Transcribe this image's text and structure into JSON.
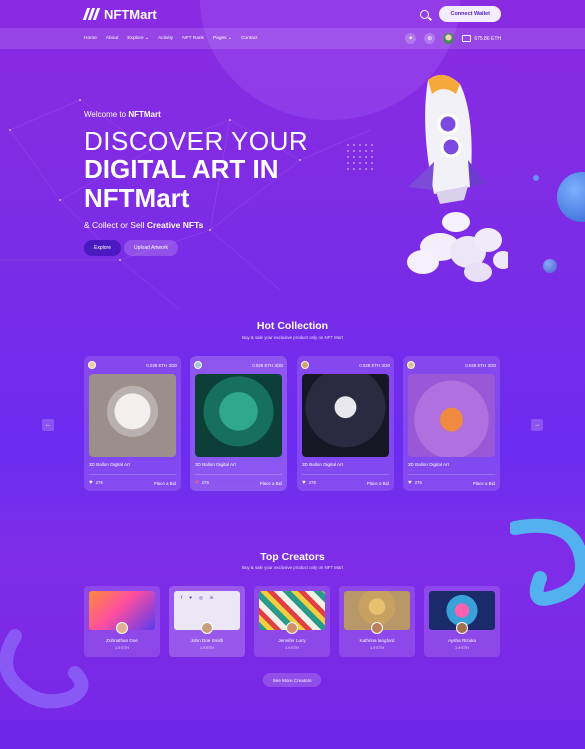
{
  "header": {
    "logo": "NFTMart",
    "connect_label": "Connect Wallet",
    "nav": [
      "Home",
      "About",
      "Explore",
      "Activity",
      "NFT Rank",
      "Pages",
      "Contact"
    ],
    "balance": "675.86 ETH"
  },
  "hero": {
    "welcome_prefix": "Welcome to",
    "welcome_brand": "NFTMart",
    "line1": "DISCOVER YOUR",
    "line2": "DIGITAL ART IN",
    "line3": "NFTMart",
    "sub_prefix": "& Collect or Sell",
    "sub_bold": "Creative NFTs",
    "explore_label": "Explore",
    "upload_label": "Upload Artwork"
  },
  "hot": {
    "title": "Hot Collection",
    "subtitle": "Buy & sale your exclusive product only on NFT Mart",
    "cards": [
      {
        "price": "0.028 ETH 3/20",
        "title": "3D Ballon Digital Art",
        "likes": "276",
        "bid": "Place a Bid"
      },
      {
        "price": "0.028 ETH 3/20",
        "title": "3D Ballon Digital Art",
        "likes": "276",
        "bid": "Place a Bid"
      },
      {
        "price": "0.028 ETH 3/20",
        "title": "3D Ballon Digital Art",
        "likes": "276",
        "bid": "Place a Bid"
      },
      {
        "price": "0.028 ETH 3/20",
        "title": "3D Ballon Digital Art",
        "likes": "276",
        "bid": "Place a Bid"
      }
    ],
    "prev": "←",
    "next": "→"
  },
  "creators": {
    "title": "Top Creators",
    "subtitle": "Buy & sale your exclusive product only on NFT Mart",
    "list": [
      {
        "name": "Zohnathan Doe",
        "eth": "1.9 ETH"
      },
      {
        "name": "John Doe Smith",
        "eth": "1.9 ETH"
      },
      {
        "name": "Jennifer Lucy",
        "eth": "1.9 ETH"
      },
      {
        "name": "Kathrina langford",
        "eth": "1.9 ETH"
      },
      {
        "name": "Aysha Rizuka",
        "eth": "1.9 ETH"
      }
    ],
    "more_label": "See More Creators"
  },
  "colors": {
    "accent": "#4a1ac0",
    "heart_active": "#ff5a6a"
  }
}
